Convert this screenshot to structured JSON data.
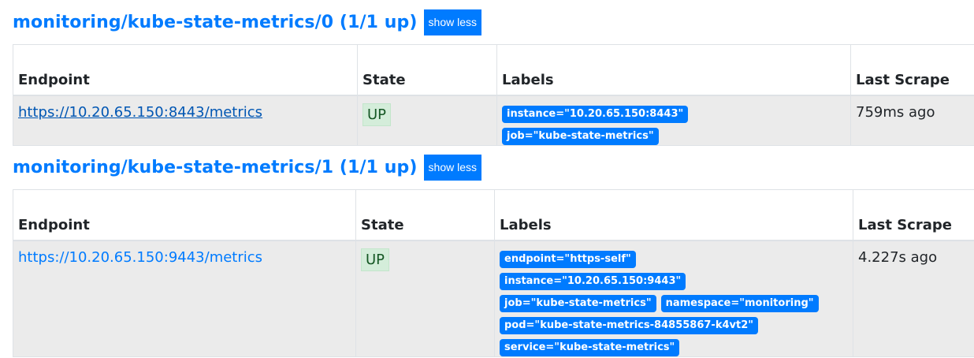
{
  "groups": [
    {
      "title": "monitoring/kube-state-metrics/0 (1/1 up)",
      "toggle_label": "show less",
      "columns": [
        "Endpoint",
        "State",
        "Labels",
        "Last Scrape"
      ],
      "rows": [
        {
          "endpoint": "https://10.20.65.150:8443/metrics",
          "state": "UP",
          "labels": [
            "instance=\"10.20.65.150:8443\"",
            "job=\"kube-state-metrics\""
          ],
          "last_scrape": "759ms ago"
        }
      ]
    },
    {
      "title": "monitoring/kube-state-metrics/1 (1/1 up)",
      "toggle_label": "show less",
      "columns": [
        "Endpoint",
        "State",
        "Labels",
        "Last Scrape"
      ],
      "rows": [
        {
          "endpoint": "https://10.20.65.150:9443/metrics",
          "state": "UP",
          "labels": [
            "endpoint=\"https-self\"",
            "instance=\"10.20.65.150:9443\"",
            "job=\"kube-state-metrics\"",
            "namespace=\"monitoring\"",
            "pod=\"kube-state-metrics-84855867-k4vt2\"",
            "service=\"kube-state-metrics\""
          ],
          "last_scrape": "4.227s ago"
        }
      ]
    }
  ],
  "colors": {
    "accent": "#007bff",
    "state_up_bg": "#d4edda",
    "state_up_text": "#155724",
    "row_bg": "#ebebeb"
  }
}
